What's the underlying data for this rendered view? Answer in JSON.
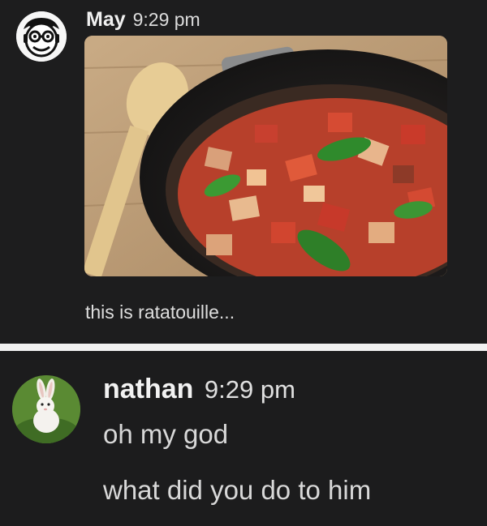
{
  "messages": [
    {
      "author": "May",
      "time": "9:29 pm",
      "avatar_icon": "cartoon-face-avatar",
      "image": "ratatouille-pan-photo",
      "lines": [
        "this is ratatouille..."
      ]
    },
    {
      "author": "nathan",
      "time": "9:29 pm",
      "avatar_icon": "white-rabbit-avatar",
      "lines": [
        "oh my god",
        "what did you do to him"
      ]
    }
  ],
  "colors": {
    "background": "#1d1d1e",
    "divider": "#f2f2f2",
    "text": "#e6e6e6"
  }
}
